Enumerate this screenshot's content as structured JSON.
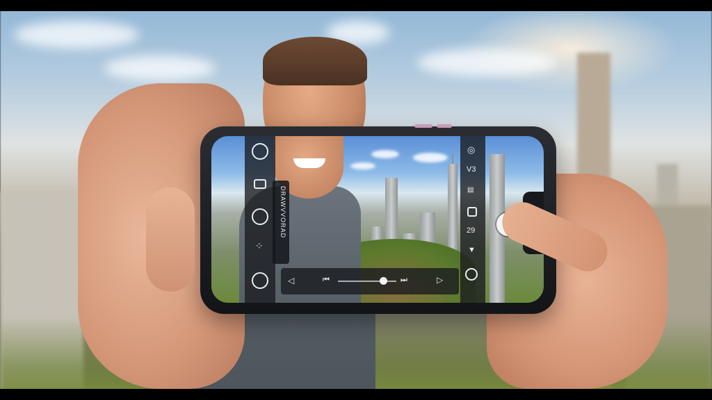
{
  "scene": {
    "description_colors": {
      "sky": "#8fb5d6",
      "shirt": "#5f6870",
      "phone_body": "#1f2126",
      "ui_panel": "#191b1f",
      "ui_fg": "#e9eef2"
    }
  },
  "phone_ui": {
    "left_toolbar": {
      "top_icon": "rotate-camera-icon",
      "check_icon": "checkbox-checked-icon",
      "battery_icon": "battery-icon",
      "grid_icon": "grid-icon",
      "stop_icon": "square-stop-icon"
    },
    "menu_label": "DRAWVVORAD",
    "player": {
      "back_icon": "triangle-left-icon",
      "prev_icon": "skip-previous-icon",
      "next_icon": "skip-next-icon",
      "play_icon": "play-icon",
      "progress": 0.78
    },
    "right_toolbar": {
      "top_label": "V3",
      "count_label": "29",
      "gear_icon": "settings-icon",
      "square_icon": "square-icon",
      "down_icon": "triangle-down-icon",
      "circle_icon": "circle-icon"
    },
    "shutter_icon": "shutter-button-icon"
  }
}
